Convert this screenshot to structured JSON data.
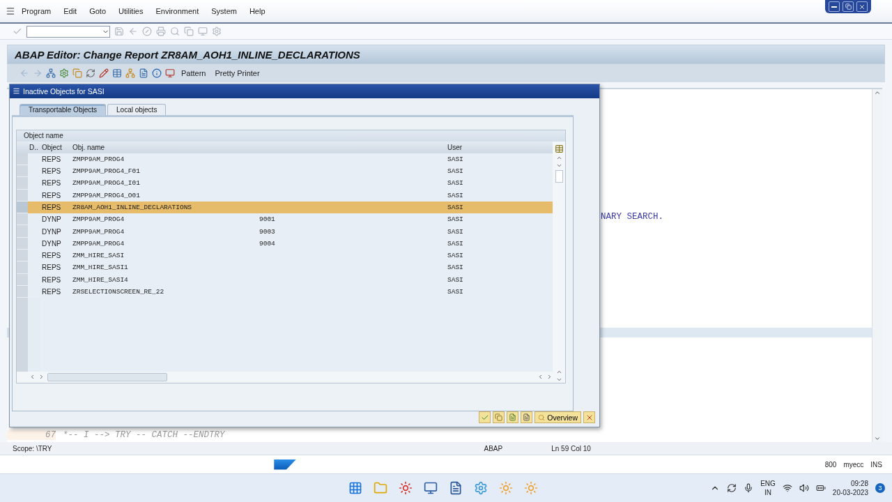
{
  "menu_bar": {
    "items": [
      "Program",
      "Edit",
      "Goto",
      "Utilities",
      "Environment",
      "System",
      "Help"
    ]
  },
  "screen": {
    "title": "ABAP Editor: Change Report ZR8AM_AOH1_INLINE_DECLARATIONS"
  },
  "app_toolbar": {
    "buttons": [
      "Pattern",
      "Pretty Printer"
    ]
  },
  "editor": {
    "lines": [
      {
        "kind": "fragment",
        "text": "NARY SEARCH."
      },
      {
        "kind": "numbered",
        "number": "67",
        "text": "*-- I --> TRY -- CATCH --ENDTRY"
      }
    ]
  },
  "dialog": {
    "title": "Inactive Objects for SASI",
    "tabs": [
      {
        "label": "Transportable Objects",
        "selected": true
      },
      {
        "label": "Local objects",
        "selected": false
      }
    ],
    "table": {
      "caption": "Object name",
      "columns": [
        "D..",
        "Object",
        "Obj. name",
        "User"
      ],
      "rows": [
        {
          "object": "REPS",
          "obj_name": "ZMPP9AM_PROG4",
          "user": "SASI",
          "selected": false
        },
        {
          "object": "REPS",
          "obj_name": "ZMPP9AM_PROG4_F01",
          "user": "SASI",
          "selected": false
        },
        {
          "object": "REPS",
          "obj_name": "ZMPP9AM_PROG4_I01",
          "user": "SASI",
          "selected": false
        },
        {
          "object": "REPS",
          "obj_name": "ZMPP9AM_PROG4_O01",
          "user": "SASI",
          "selected": false
        },
        {
          "object": "REPS",
          "obj_name": "ZR8AM_AOH1_INLINE_DECLARATIONS",
          "user": "SASI",
          "selected": true
        },
        {
          "object": "DYNP",
          "obj_name": "ZMPP9AM_PROG4",
          "column_4": "9001",
          "user": "SASI",
          "selected": false
        },
        {
          "object": "DYNP",
          "obj_name": "ZMPP9AM_PROG4",
          "column_4": "9003",
          "user": "SASI",
          "selected": false
        },
        {
          "object": "DYNP",
          "obj_name": "ZMPP9AM_PROG4",
          "column_4": "9004",
          "user": "SASI",
          "selected": false
        },
        {
          "object": "REPS",
          "obj_name": "ZMM_HIRE_SASI",
          "user": "SASI",
          "selected": false
        },
        {
          "object": "REPS",
          "obj_name": "ZMM_HIRE_SASI1",
          "user": "SASI",
          "selected": false
        },
        {
          "object": "REPS",
          "obj_name": "ZMM_HIRE_SASI4",
          "user": "SASI",
          "selected": false
        },
        {
          "object": "REPS",
          "obj_name": "ZRSELECTIONSCREEN_RE_22",
          "user": "SASI",
          "selected": false
        }
      ]
    },
    "buttons": [
      "Overview"
    ]
  },
  "status_bar": {
    "scope": "Scope: \\TRY",
    "language": "ABAP",
    "position": "Ln 59 Col 10"
  },
  "sap_bar": {
    "client": "800",
    "system": "myecc",
    "mode": "INS"
  },
  "taskbar": {
    "language": "ENG",
    "region": "IN",
    "time": "09:28",
    "date": "20-03-2023",
    "notifications": "3"
  }
}
